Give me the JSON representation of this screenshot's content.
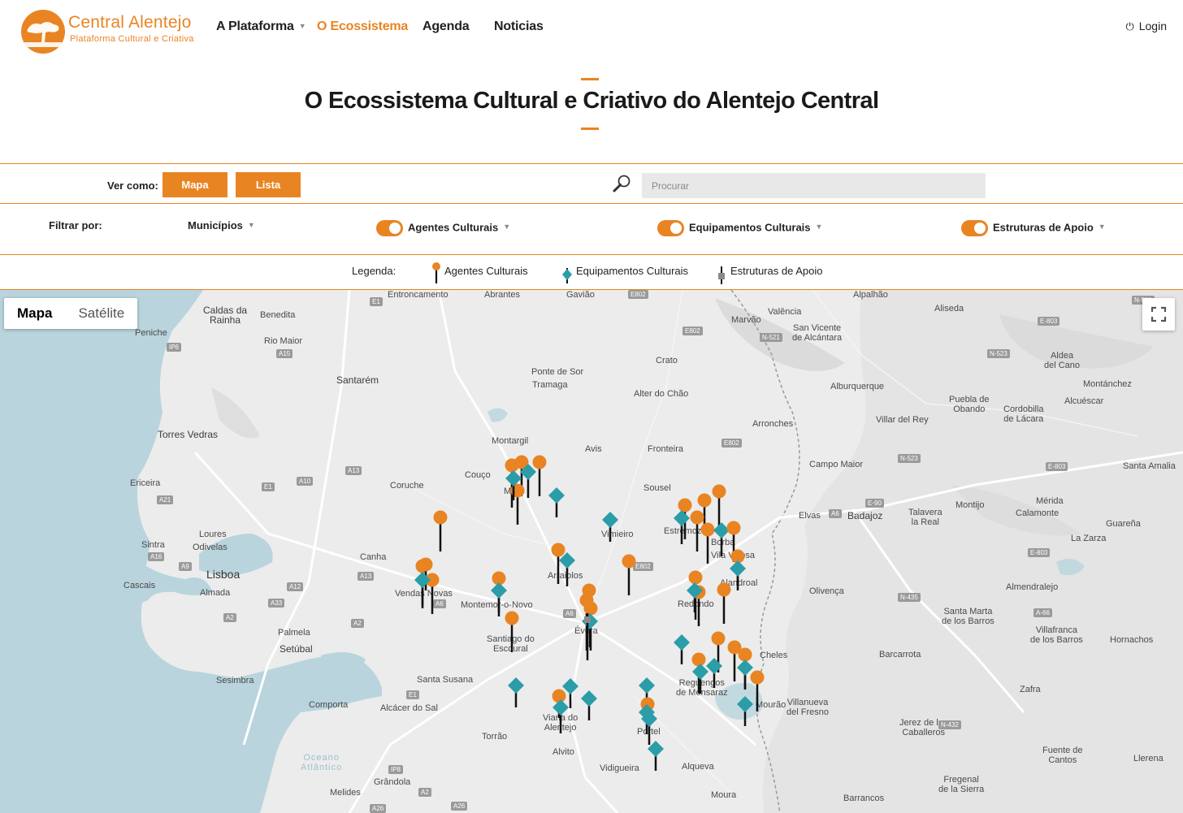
{
  "logo": {
    "title": "Central Alentejo",
    "subtitle": "Plataforma Cultural e Criativa"
  },
  "nav": {
    "items": [
      {
        "label": "A Plataforma",
        "has_caret": true
      },
      {
        "label": "O Ecossistema",
        "active": true
      },
      {
        "label": "Agenda"
      },
      {
        "label": "Noticias"
      }
    ],
    "login": "Login"
  },
  "page_title": "O Ecossistema Cultural e Criativo do Alentejo Central",
  "view": {
    "label": "Ver como:",
    "map_button": "Mapa",
    "list_button": "Lista"
  },
  "search": {
    "placeholder": "Procurar"
  },
  "filter": {
    "label": "Filtrar por:",
    "municipios": "Municípios",
    "agentes": "Agentes Culturais",
    "equipamentos": "Equipamentos Culturais",
    "estruturas": "Estruturas de Apoio"
  },
  "legend": {
    "label": "Legenda:",
    "agentes": "Agentes Culturais",
    "equipamentos": "Equipamentos Culturais",
    "estruturas": "Estruturas de Apoio"
  },
  "map": {
    "type_map": "Mapa",
    "type_satellite": "Satélite",
    "places": [
      "Entroncamento",
      "Abrantes",
      "Gavião",
      "Alpalhão",
      "Caldas da Rainha",
      "Benedita",
      "Peniche",
      "Rio Maior",
      "Santarém",
      "Ponte de Sor",
      "Tramaga",
      "Crato",
      "Alter do Chão",
      "Marvão",
      "Valência",
      "San Vicente de Alcántara",
      "Alburquerque",
      "Aliseda",
      "Aldea del Cano",
      "Torres Vedras",
      "Montargil",
      "Avis",
      "Fronteira",
      "Arronches",
      "Villar del Rey",
      "Puebla de Obando",
      "Cordobilla de Lácara",
      "Montánchez",
      "Alcuéscar",
      "Coruche",
      "Couço",
      "Mora",
      "Ericeira",
      "Sousel",
      "Campo Maior",
      "Santa Amalia",
      "Elvas",
      "Badajoz",
      "Talavera la Real",
      "Montijo",
      "Mérida",
      "Calamonte",
      "Guareña",
      "Sintra",
      "Loures",
      "Odivelas",
      "Estremoz",
      "Borba",
      "Vila Viçosa",
      "Vimieiro",
      "Arraiolos",
      "La Zarza",
      "Canha",
      "Lisboa",
      "Cascais",
      "Almada",
      "Vendas Novas",
      "Montemor-o-Novo",
      "Alandroal",
      "Redondo",
      "Olivença",
      "Almendralejo",
      "Évora",
      "Santa Marta de los Barros",
      "Palmela",
      "Setúbal",
      "Santiago do Escoural",
      "Villafranca de los Barros",
      "Hornachos",
      "Cheles",
      "Barcarrota",
      "Sesimbra",
      "Santa Susana",
      "Reguengos de Monsaraz",
      "Zafra",
      "Comporta",
      "Alcácer do Sal",
      "Viana do Alentejo",
      "Mourão",
      "Villanueva del Fresno",
      "Portel",
      "Jerez de los Caballeros",
      "Torrão",
      "Alvito",
      "Vidigueira",
      "Alqueva",
      "Fuente de Cantos",
      "Llerena",
      "Grândola",
      "Melides",
      "Moura",
      "Fregenal de la Sierra",
      "Barrancos",
      "Oceano Atlântico"
    ]
  },
  "colors": {
    "accent": "#e98422",
    "teal": "#2a9da8",
    "map_bg": "#ececec"
  },
  "icons": [
    "tree-logo-icon",
    "power-icon",
    "search-icon",
    "fullscreen-icon",
    "agent-pin-icon",
    "equipment-diamond-icon",
    "support-square-icon"
  ]
}
